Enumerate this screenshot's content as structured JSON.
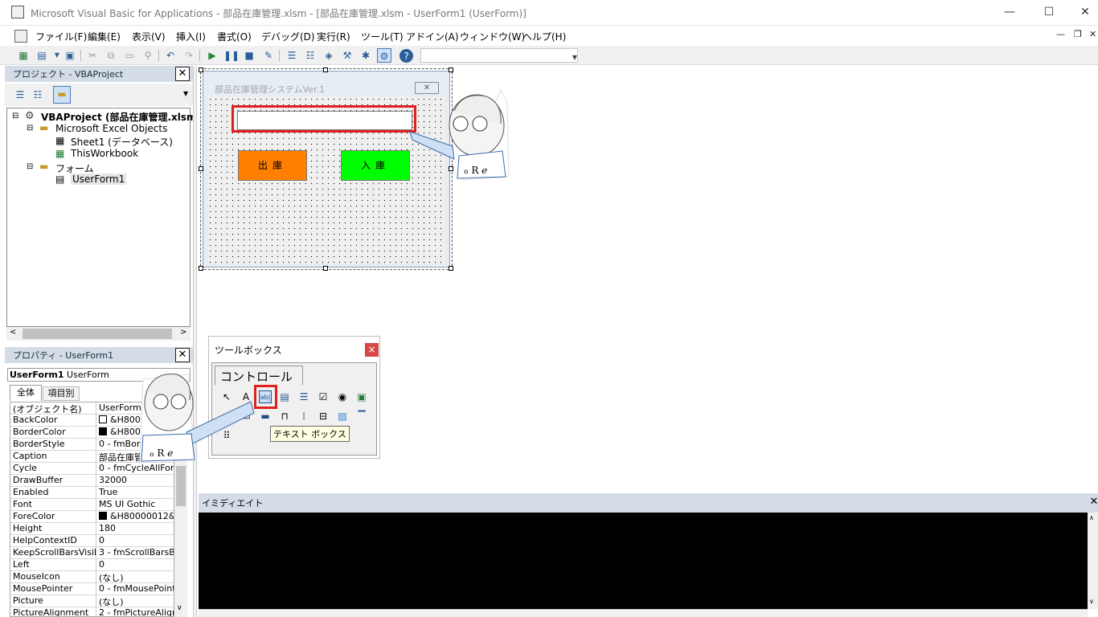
{
  "window": {
    "title": "Microsoft Visual Basic for Applications - 部品在庫管理.xlsm - [部品在庫管理.xlsm - UserForm1 (UserForm)]",
    "controls": {
      "minimize": "—",
      "maximize": "☐",
      "close": "✕"
    }
  },
  "menu": {
    "items": [
      "ファイル(F)",
      "編集(E)",
      "表示(V)",
      "挿入(I)",
      "書式(O)",
      "デバッグ(D)",
      "実行(R)",
      "ツール(T)",
      "アドイン(A)",
      "ウィンドウ(W)",
      "ヘルプ(H)"
    ],
    "mdi_controls": {
      "minimize": "—",
      "restore": "❐",
      "close": "✕"
    }
  },
  "project_panel": {
    "title": "プロジェクト - VBAProject",
    "close": "✕",
    "tree": {
      "root": "VBAProject (部品在庫管理.xlsm",
      "excel_objects": "Microsoft Excel Objects",
      "sheet1": "Sheet1 (データベース)",
      "thisworkbook": "ThisWorkbook",
      "forms_folder": "フォーム",
      "userform": "UserForm1"
    }
  },
  "properties_panel": {
    "title": "プロパティ - UserForm1",
    "close": "✕",
    "object_name": "UserForm1",
    "object_type": "UserForm",
    "tabs": [
      "全体",
      "項目別"
    ],
    "rows": [
      {
        "name": "(オブジェクト名)",
        "value": "UserForm1"
      },
      {
        "name": "BackColor",
        "value": "&H8000000",
        "swatch": "#ffffff"
      },
      {
        "name": "BorderColor",
        "value": "&H8000001",
        "swatch": "#000000"
      },
      {
        "name": "BorderStyle",
        "value": "0 - fmBor"
      },
      {
        "name": "Caption",
        "value": "部品在庫管"
      },
      {
        "name": "Cycle",
        "value": "0 - fmCycleAllFor"
      },
      {
        "name": "DrawBuffer",
        "value": "32000"
      },
      {
        "name": "Enabled",
        "value": "True"
      },
      {
        "name": "Font",
        "value": "MS UI Gothic"
      },
      {
        "name": "ForeColor",
        "value": "&H80000012&",
        "swatch": "#000000"
      },
      {
        "name": "Height",
        "value": "180"
      },
      {
        "name": "HelpContextID",
        "value": "0"
      },
      {
        "name": "KeepScrollBarsVisib",
        "value": "3 - fmScrollBarsB"
      },
      {
        "name": "Left",
        "value": "0"
      },
      {
        "name": "MouseIcon",
        "value": "(なし)"
      },
      {
        "name": "MousePointer",
        "value": "0 - fmMousePointe"
      },
      {
        "name": "Picture",
        "value": "(なし)"
      },
      {
        "name": "PictureAlignment",
        "value": "2 - fmPictureAlign"
      }
    ]
  },
  "userform": {
    "caption": "部品在庫管理システムVer.1",
    "close": "✕",
    "button_out": "出庫",
    "button_in": "入庫"
  },
  "toolbox": {
    "title": "ツールボックス",
    "close": "×",
    "tab": "コントロール",
    "tooltip": "テキスト ボックス"
  },
  "immediate": {
    "title": "イミディエイト",
    "close": "✕"
  },
  "colors": {
    "highlight": "#e02020",
    "btn_out": "#ff7f00",
    "btn_in": "#00ff00",
    "panel_header": "#d3dce7"
  }
}
